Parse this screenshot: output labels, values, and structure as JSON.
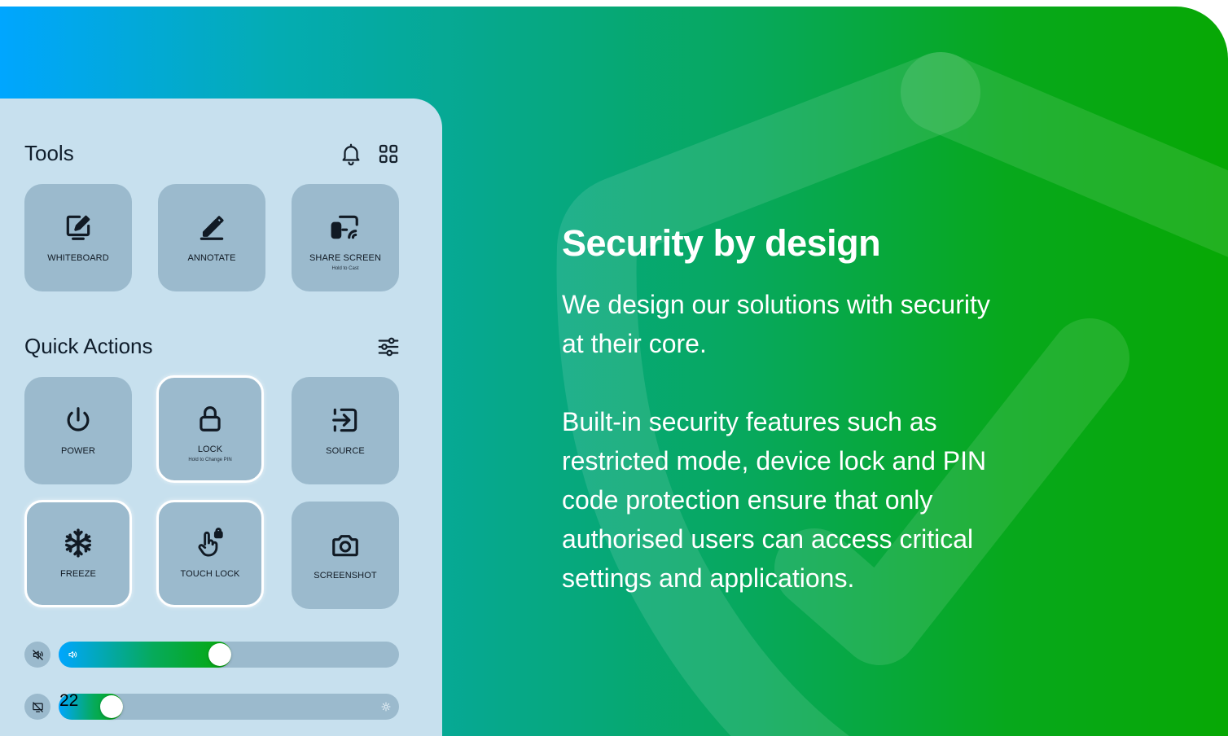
{
  "hero": {
    "heading": "Security by design",
    "paragraph_1": "We design our solutions with security at their core.",
    "paragraph_2": "Built-in security features such as restricted mode, device lock and PIN code protection ensure that only authorised users can access critical settings and applications."
  },
  "panel": {
    "tools": {
      "title": "Tools",
      "header_icons": [
        "bell-icon",
        "grid-icon"
      ],
      "items": [
        {
          "label": "WHITEBOARD",
          "icon": "whiteboard-icon"
        },
        {
          "label": "ANNOTATE",
          "icon": "pen-icon"
        },
        {
          "label": "SHARE SCREEN",
          "sublabel": "Hold to Cast",
          "icon": "cast-icon"
        }
      ]
    },
    "quick_actions": {
      "title": "Quick Actions",
      "header_icons": [
        "sliders-icon"
      ],
      "items": [
        {
          "label": "POWER",
          "icon": "power-icon",
          "highlighted": false
        },
        {
          "label": "LOCK",
          "sublabel": "Hold to Change PIN",
          "icon": "lock-icon",
          "highlighted": true
        },
        {
          "label": "SOURCE",
          "icon": "source-icon",
          "highlighted": false
        },
        {
          "label": "FREEZE",
          "icon": "snowflake-icon",
          "highlighted": true
        },
        {
          "label": "TOUCH LOCK",
          "icon": "touch-lock-icon",
          "highlighted": true
        },
        {
          "label": "SCREENSHOT",
          "icon": "camera-icon",
          "highlighted": false
        }
      ]
    },
    "volume": {
      "value_fraction": 0.47,
      "icon": "mute-icon",
      "inner_icon": "speaker-icon"
    },
    "brightness": {
      "value": "22",
      "value_fraction": 0.15,
      "icon": "screen-off-icon",
      "end_icon": "sun-icon"
    }
  },
  "colors": {
    "gradient_start": "#00a6ff",
    "gradient_end": "#07a804",
    "panel_bg": "#c7e0ee",
    "tile_bg": "#9bbacd"
  }
}
